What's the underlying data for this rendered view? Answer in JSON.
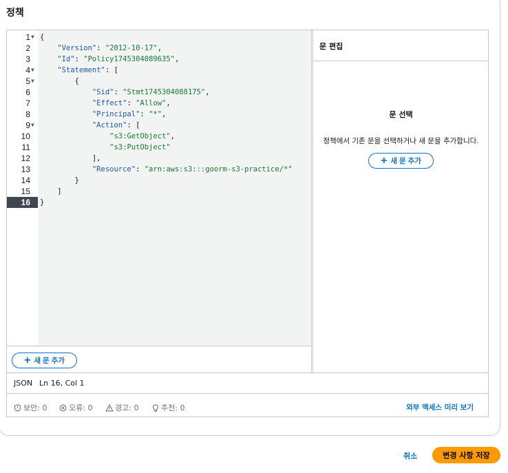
{
  "page": {
    "title": "정책"
  },
  "code": {
    "lines": [
      {
        "n": "1",
        "fold": true,
        "parts": [
          [
            "p",
            "{"
          ]
        ]
      },
      {
        "n": "2",
        "fold": false,
        "parts": [
          [
            "p",
            "    "
          ],
          [
            "k",
            "\"Version\""
          ],
          [
            "p",
            ": "
          ],
          [
            "s",
            "\"2012-10-17\""
          ],
          [
            "p",
            ","
          ]
        ]
      },
      {
        "n": "3",
        "fold": false,
        "parts": [
          [
            "p",
            "    "
          ],
          [
            "k",
            "\"Id\""
          ],
          [
            "p",
            ": "
          ],
          [
            "s",
            "\"Policy1745304089635\""
          ],
          [
            "p",
            ","
          ]
        ]
      },
      {
        "n": "4",
        "fold": true,
        "parts": [
          [
            "p",
            "    "
          ],
          [
            "k",
            "\"Statement\""
          ],
          [
            "p",
            ": ["
          ]
        ]
      },
      {
        "n": "5",
        "fold": true,
        "parts": [
          [
            "p",
            "        {"
          ]
        ]
      },
      {
        "n": "6",
        "fold": false,
        "parts": [
          [
            "p",
            "            "
          ],
          [
            "k",
            "\"Sid\""
          ],
          [
            "p",
            ": "
          ],
          [
            "s",
            "\"Stmt1745304088175\""
          ],
          [
            "p",
            ","
          ]
        ]
      },
      {
        "n": "7",
        "fold": false,
        "parts": [
          [
            "p",
            "            "
          ],
          [
            "k",
            "\"Effect\""
          ],
          [
            "p",
            ": "
          ],
          [
            "s",
            "\"Allow\""
          ],
          [
            "p",
            ","
          ]
        ]
      },
      {
        "n": "8",
        "fold": false,
        "parts": [
          [
            "p",
            "            "
          ],
          [
            "k",
            "\"Principal\""
          ],
          [
            "p",
            ": "
          ],
          [
            "s",
            "\"*\""
          ],
          [
            "p",
            ","
          ]
        ]
      },
      {
        "n": "9",
        "fold": true,
        "parts": [
          [
            "p",
            "            "
          ],
          [
            "k",
            "\"Action\""
          ],
          [
            "p",
            ": ["
          ]
        ]
      },
      {
        "n": "10",
        "fold": false,
        "parts": [
          [
            "p",
            "                "
          ],
          [
            "s",
            "\"s3:GetObject\""
          ],
          [
            "p",
            ","
          ]
        ]
      },
      {
        "n": "11",
        "fold": false,
        "parts": [
          [
            "p",
            "                "
          ],
          [
            "s",
            "\"s3:PutObject\""
          ]
        ]
      },
      {
        "n": "12",
        "fold": false,
        "parts": [
          [
            "p",
            "            ],"
          ]
        ]
      },
      {
        "n": "13",
        "fold": false,
        "parts": [
          [
            "p",
            "            "
          ],
          [
            "k",
            "\"Resource\""
          ],
          [
            "p",
            ": "
          ],
          [
            "s",
            "\"arn:aws:s3:::goorm-s3-practice/*\""
          ]
        ]
      },
      {
        "n": "14",
        "fold": false,
        "parts": [
          [
            "p",
            "        }"
          ]
        ]
      },
      {
        "n": "15",
        "fold": false,
        "parts": [
          [
            "p",
            "    ]"
          ]
        ]
      },
      {
        "n": "16",
        "fold": false,
        "parts": [
          [
            "p",
            "}"
          ]
        ]
      }
    ],
    "active_line": "16"
  },
  "statement_panel": {
    "header": "문 편집",
    "select_title": "문 선택",
    "select_desc": "정책에서 기존 문을 선택하거나 새 문을 추가합니다.",
    "add_label": "새 문 추가"
  },
  "editor_footer": {
    "add_label": "새 문 추가"
  },
  "status": {
    "mode": "JSON",
    "position": "Ln 16, Col 1"
  },
  "lint": {
    "security": "보안: 0",
    "errors": "오류: 0",
    "warnings": "경고: 0",
    "suggestions": "추천: 0",
    "preview_link": "외부 액세스 미리 보기"
  },
  "actions": {
    "cancel": "취소",
    "save": "변경 사항 저장"
  },
  "colors": {
    "accent": "#0972d3",
    "primary_button": "#ff9900",
    "json_key": "#1b5aa9",
    "json_string": "#137c34"
  },
  "icons": [
    "chevron-down-icon",
    "plus-icon",
    "shield-icon",
    "error-circle-icon",
    "warning-triangle-icon",
    "lightbulb-icon"
  ]
}
